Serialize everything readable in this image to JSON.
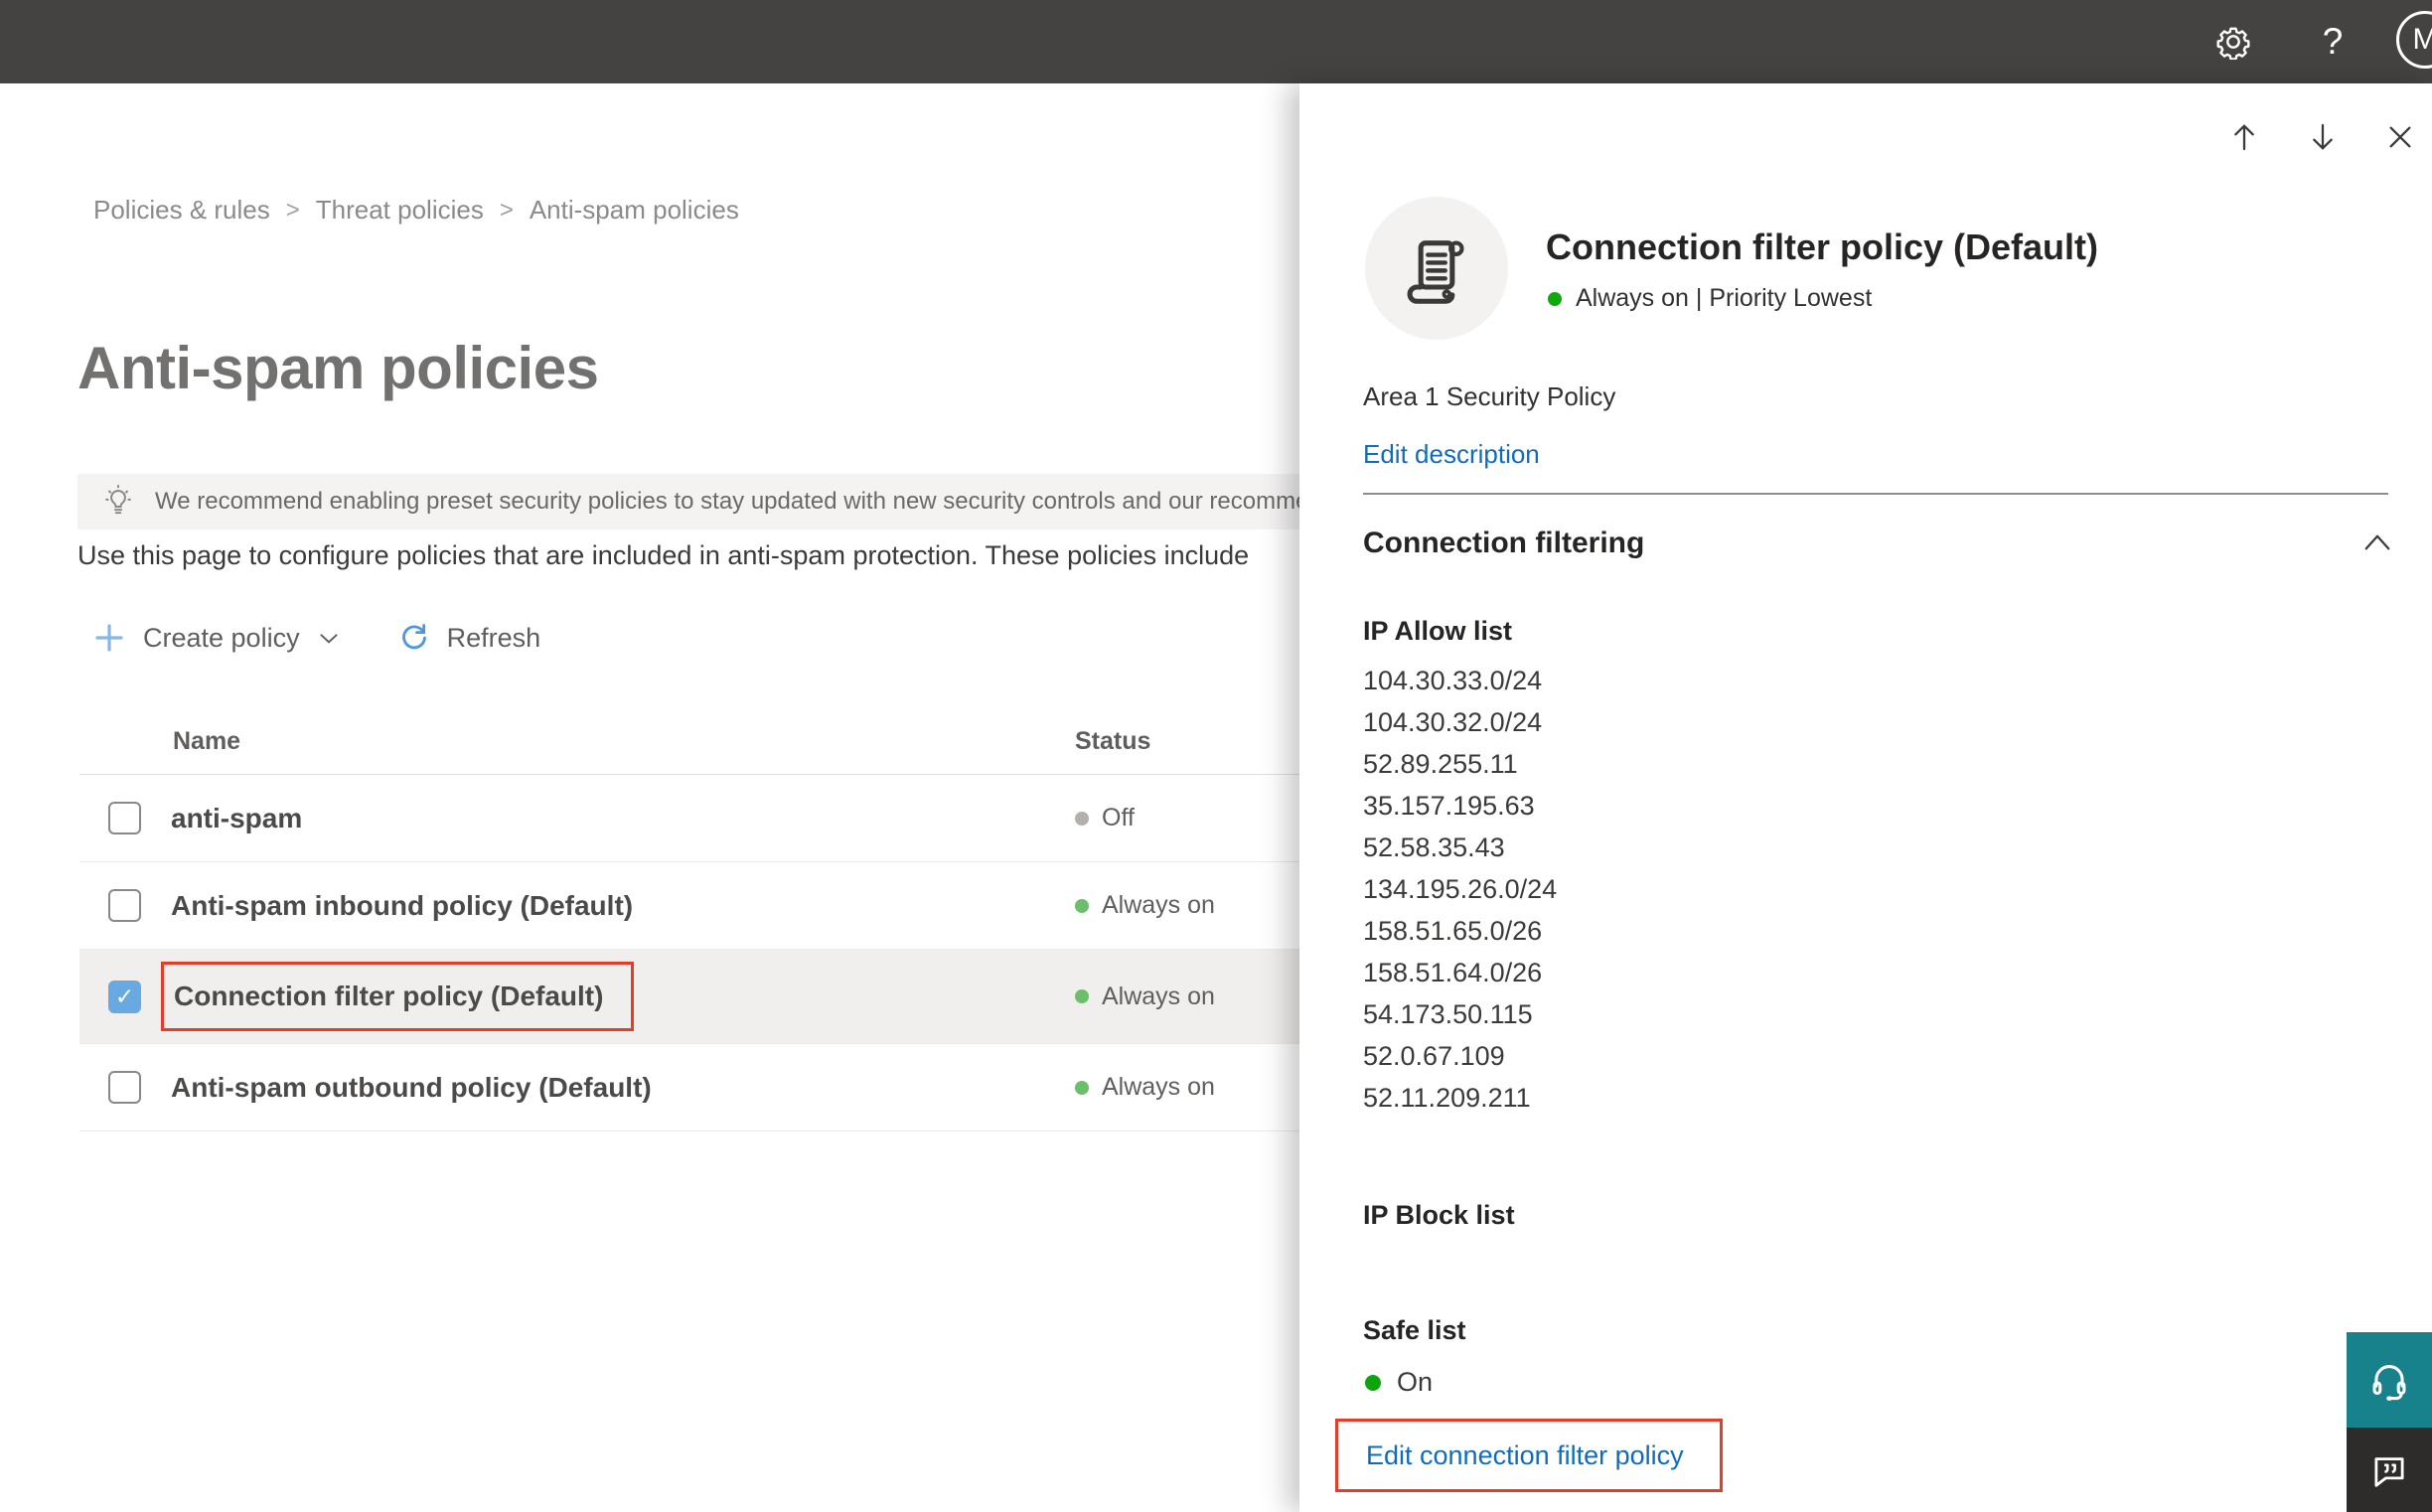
{
  "topbar": {
    "help_label": "?",
    "avatar_initial": "M"
  },
  "breadcrumb": {
    "separator": ">",
    "items": [
      "Policies & rules",
      "Threat policies",
      "Anti-spam policies"
    ]
  },
  "main": {
    "title": "Anti-spam policies",
    "banner_text": "We recommend enabling preset security policies to stay updated with new security controls and our recomme",
    "description": "Use this page to configure policies that are included in anti-spam protection. These policies include",
    "toolbar": {
      "create_policy_label": "Create policy",
      "refresh_label": "Refresh"
    },
    "table": {
      "columns": {
        "name": "Name",
        "status": "Status"
      },
      "rows": [
        {
          "name": "anti-spam",
          "status": "Off",
          "dot_color": "#b3b0ad",
          "checked": false,
          "selected": false,
          "red_box": false
        },
        {
          "name": "Anti-spam inbound policy (Default)",
          "status": "Always on",
          "dot_color": "#6bbf6b",
          "checked": false,
          "selected": false,
          "red_box": false
        },
        {
          "name": "Connection filter policy (Default)",
          "status": "Always on",
          "dot_color": "#6bbf6b",
          "checked": true,
          "selected": true,
          "red_box": true
        },
        {
          "name": "Anti-spam outbound policy (Default)",
          "status": "Always on",
          "dot_color": "#6bbf6b",
          "checked": false,
          "selected": false,
          "red_box": false
        }
      ]
    }
  },
  "flyout": {
    "title": "Connection filter policy (Default)",
    "status_text": "Always on | Priority Lowest",
    "status_dot_color": "#0fa90f",
    "policy_description": "Area 1 Security Policy",
    "edit_description_label": "Edit description",
    "section_heading": "Connection filtering",
    "ip_allow_heading": "IP Allow list",
    "ip_allow_list": [
      "104.30.33.0/24",
      "104.30.32.0/24",
      "52.89.255.11",
      "35.157.195.63",
      "52.58.35.43",
      "134.195.26.0/24",
      "158.51.65.0/26",
      "158.51.64.0/26",
      "54.173.50.115",
      "52.0.67.109",
      "52.11.209.211"
    ],
    "ip_block_heading": "IP Block list",
    "safe_list_heading": "Safe list",
    "safe_list_status": "On",
    "safe_list_dot_color": "#0ca50c",
    "edit_link_label": "Edit connection filter policy"
  },
  "colors": {
    "topbar_bg": "#454341",
    "accent_blue": "#0f6cbd",
    "annotation_red": "#e23e2a",
    "checkbox_checked": "#69a9e2",
    "selected_row_bg": "#f0efed",
    "banner_bg": "#f4f3f2",
    "support_teal": "#17818c",
    "feedback_dark": "#2d2c2b"
  }
}
